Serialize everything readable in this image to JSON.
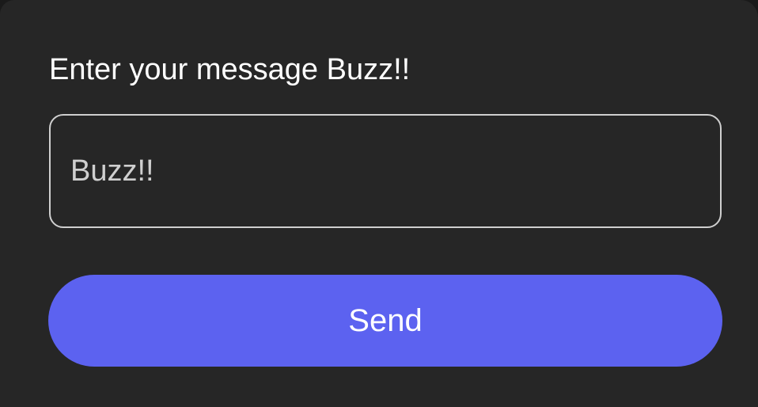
{
  "dialog": {
    "prompt": "Enter your message Buzz!!",
    "message_input": {
      "value": "Buzz!!",
      "placeholder": ""
    },
    "send_label": "Send"
  },
  "colors": {
    "background": "#262626",
    "field_border": "#cfcfcf",
    "text": "#ffffff",
    "input_text": "#cfcfcf",
    "accent": "#5c62f0"
  }
}
